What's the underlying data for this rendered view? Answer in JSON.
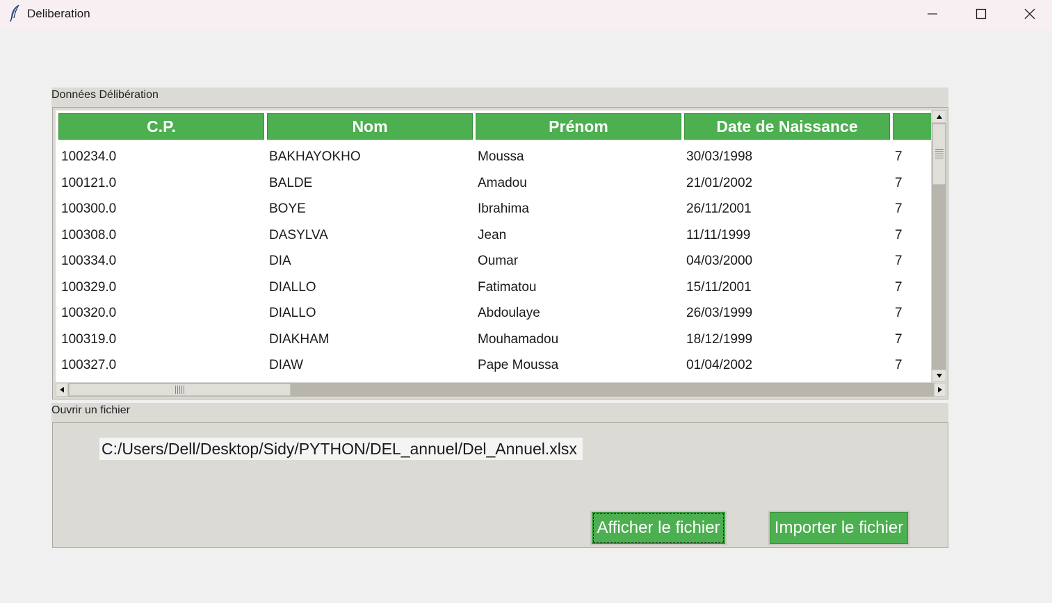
{
  "window": {
    "title": "Deliberation",
    "icon": "feather-icon",
    "controls": [
      "minimize-icon",
      "maximize-icon",
      "close-icon"
    ]
  },
  "deliberation_frame": {
    "label": "Données Délibération",
    "columns": [
      "C.P.",
      "Nom",
      "Prénom",
      "Date de Naissance",
      ""
    ],
    "rows": [
      [
        "100234.0",
        "BAKHAYOKHO",
        "Moussa",
        "30/03/1998",
        "7"
      ],
      [
        "100121.0",
        "BALDE",
        "Amadou",
        "21/01/2002",
        "7"
      ],
      [
        "100300.0",
        "BOYE",
        "Ibrahima",
        "26/11/2001",
        "7"
      ],
      [
        "100308.0",
        "DASYLVA",
        "Jean",
        "11/11/1999",
        "7"
      ],
      [
        "100334.0",
        "DIA",
        "Oumar",
        "04/03/2000",
        "7"
      ],
      [
        "100329.0",
        "DIALLO",
        "Fatimatou",
        "15/11/2001",
        "7"
      ],
      [
        "100320.0",
        "DIALLO",
        "Abdoulaye",
        "26/03/1999",
        "7"
      ],
      [
        "100319.0",
        "DIAKHAM",
        "Mouhamadou",
        "18/12/1999",
        "7"
      ],
      [
        "100327.0",
        "DIAW",
        "Pape Moussa",
        "01/04/2002",
        "7"
      ]
    ],
    "header_color": "#4caf50"
  },
  "file_frame": {
    "label": "Ouvrir un fichier",
    "path_value": "C:/Users/Dell/Desktop/Sidy/PYTHON/DEL_annuel/Del_Annuel.xlsx",
    "show_button_label": "Afficher le fichier",
    "import_button_label": "Importer le fichier",
    "button_color": "#4caf50"
  }
}
